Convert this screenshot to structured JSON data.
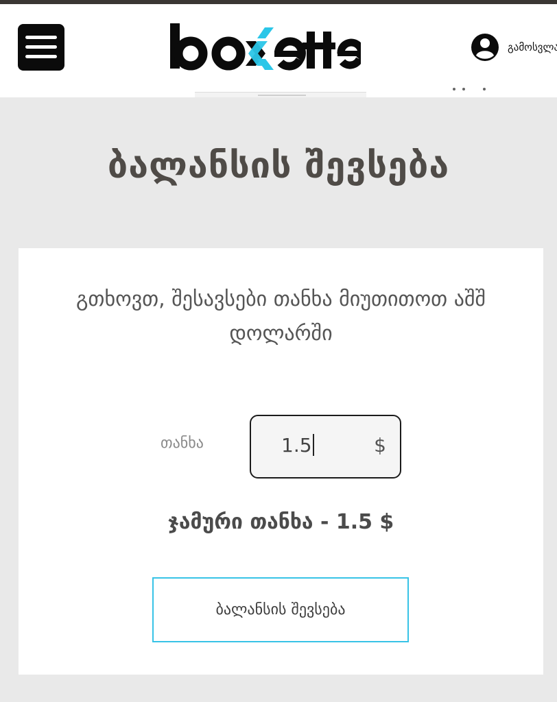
{
  "header": {
    "logo_text": "boxette",
    "logout_label": "გამოსვლა"
  },
  "page": {
    "title": "ბალანსის შევსება"
  },
  "form": {
    "instruction": "გთხოვთ, შესავსები თანხა მიუთითოთ აშშ დოლარში",
    "amount_label": "თანხა",
    "amount_value": "1.5",
    "currency_symbol": "$",
    "total_text": "ჯამური თანხა - 1.5 $",
    "submit_label": "ბალანსის შევსება"
  },
  "colors": {
    "accent": "#37c3e6",
    "logo_dark": "#0b0b0b",
    "logo_accent": "#2bc6e8",
    "background": "#e9e9e9"
  },
  "icons": {
    "menu": "hamburger-icon",
    "user": "user-circle-icon"
  }
}
